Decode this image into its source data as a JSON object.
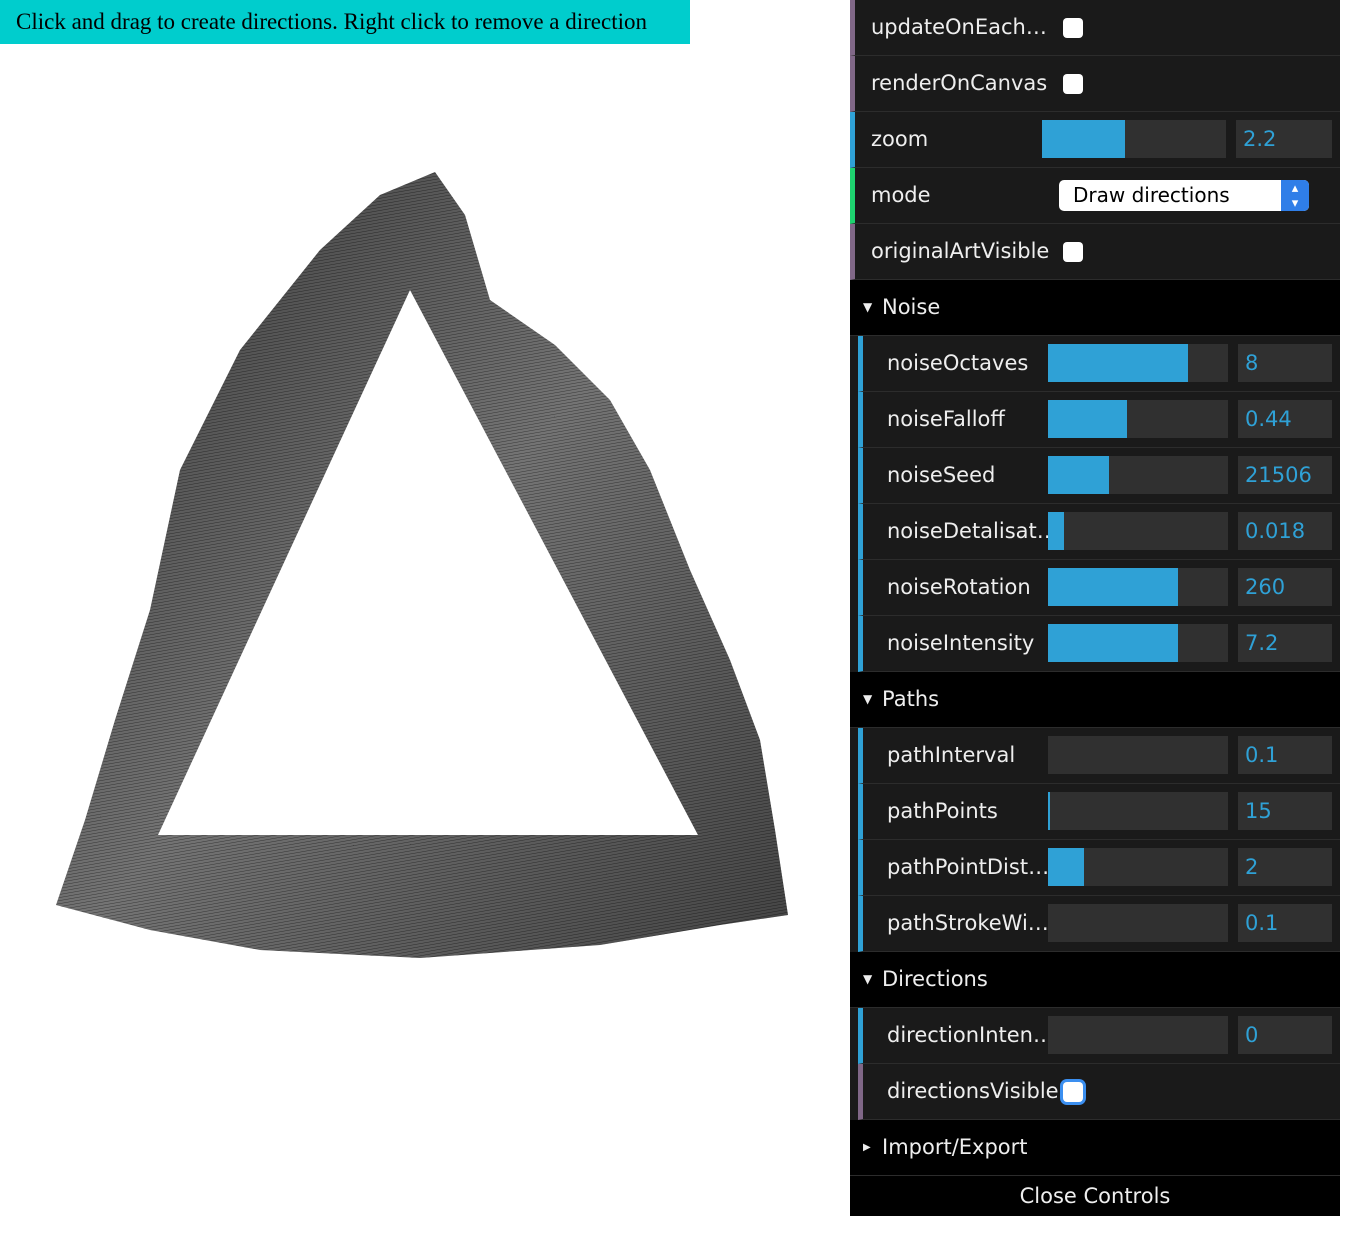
{
  "hint": "Click and drag to create directions. Right click to remove a direction",
  "canvas": {
    "stroke_color": "#1c1c1c",
    "background": "#ffffff"
  },
  "gui": {
    "top": {
      "updateOnEachChange": {
        "label": "updateOnEachC...",
        "checked": false
      },
      "renderOnCanvas": {
        "label": "renderOnCanvas",
        "checked": false
      },
      "zoom": {
        "label": "zoom",
        "value": "2.2",
        "fraction": 0.45
      },
      "mode": {
        "label": "mode",
        "value": "Draw directions"
      },
      "originalArtVisible": {
        "label": "originalArtVisible",
        "checked": false
      }
    },
    "noise": {
      "title": "Noise",
      "noiseOctaves": {
        "label": "noiseOctaves",
        "value": "8",
        "fraction": 0.78
      },
      "noiseFalloff": {
        "label": "noiseFalloff",
        "value": "0.44",
        "fraction": 0.44
      },
      "noiseSeed": {
        "label": "noiseSeed",
        "value": "21506",
        "fraction": 0.34
      },
      "noiseDetalisation": {
        "label": "noiseDetalisati...",
        "value": "0.018",
        "fraction": 0.09
      },
      "noiseRotation": {
        "label": "noiseRotation",
        "value": "260",
        "fraction": 0.72
      },
      "noiseIntensity": {
        "label": "noiseIntensity",
        "value": "7.2",
        "fraction": 0.72
      }
    },
    "paths": {
      "title": "Paths",
      "pathInterval": {
        "label": "pathInterval",
        "value": "0.1",
        "fraction": 0.0
      },
      "pathPoints": {
        "label": "pathPoints",
        "value": "15",
        "fraction": 0.01
      },
      "pathPointDistance": {
        "label": "pathPointDista...",
        "value": "2",
        "fraction": 0.2
      },
      "pathStrokeWidth": {
        "label": "pathStrokeWidth",
        "value": "0.1",
        "fraction": 0.0
      }
    },
    "directions": {
      "title": "Directions",
      "directionIntensity": {
        "label": "directionIntens...",
        "value": "0",
        "fraction": 0.0
      },
      "directionsVisible": {
        "label": "directionsVisible",
        "checked": false
      }
    },
    "importExport": {
      "title": "Import/Export"
    },
    "close_label": "Close Controls"
  }
}
